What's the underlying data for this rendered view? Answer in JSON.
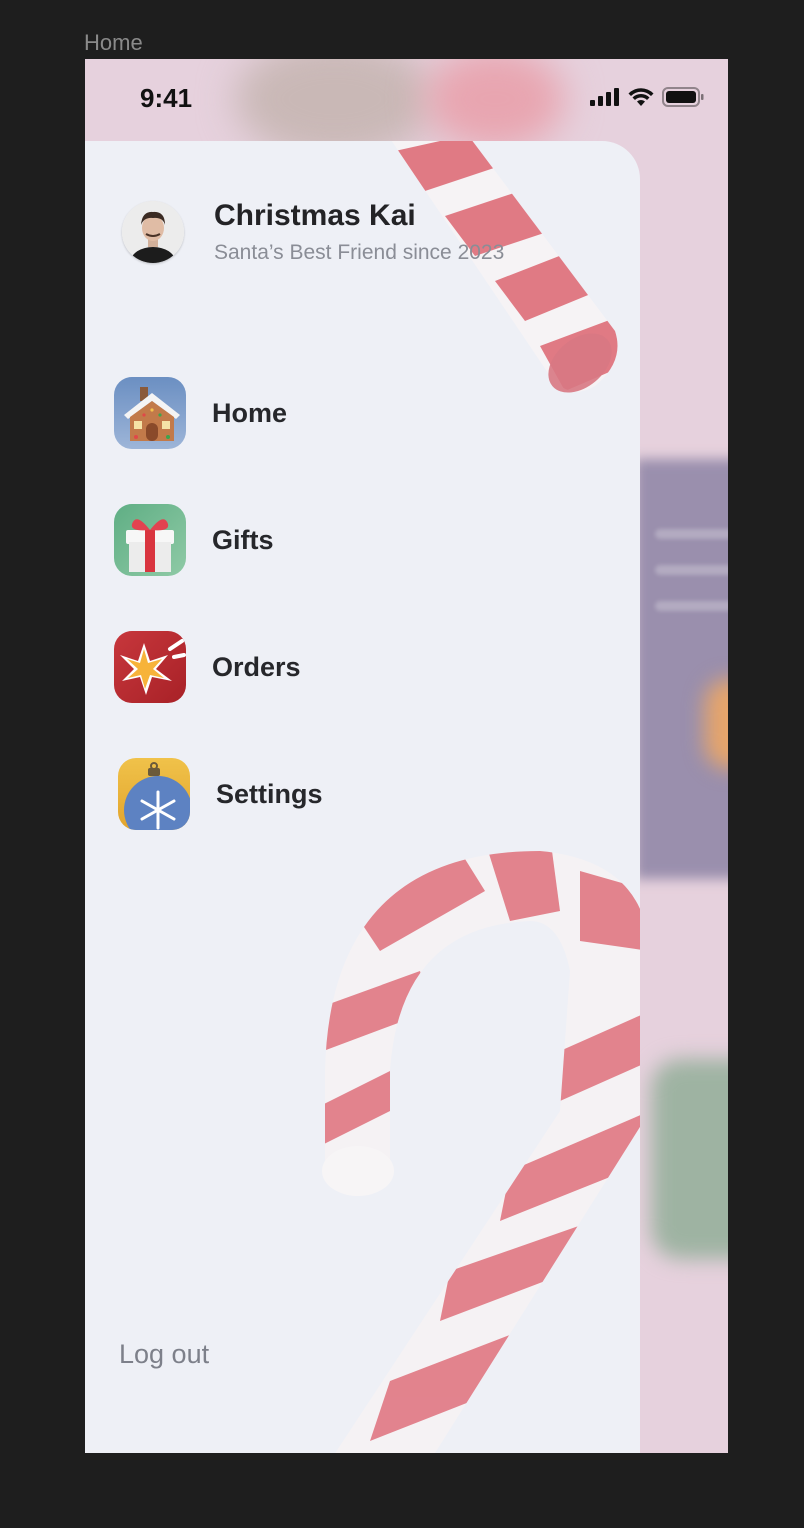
{
  "frame_label": "Home",
  "status_bar": {
    "time": "9:41",
    "icons": [
      "cellular-signal-icon",
      "wifi-icon",
      "battery-icon"
    ]
  },
  "profile": {
    "name": "Christmas Kai",
    "subtitle": "Santa’s Best Friend since 2023",
    "avatar": "avatar"
  },
  "menu": {
    "items": [
      {
        "label": "Home",
        "icon": "gingerbread-house-icon"
      },
      {
        "label": "Gifts",
        "icon": "gift-box-icon"
      },
      {
        "label": "Orders",
        "icon": "star-burst-icon"
      },
      {
        "label": "Settings",
        "icon": "ornament-icon"
      }
    ]
  },
  "footer": {
    "logout_label": "Log out"
  },
  "colors": {
    "drawer_bg": "#eef0f6",
    "backdrop_pink": "#e6d1dd",
    "text_primary": "#232326",
    "text_secondary": "#8a8d96",
    "candy_red": "#e07a84"
  }
}
